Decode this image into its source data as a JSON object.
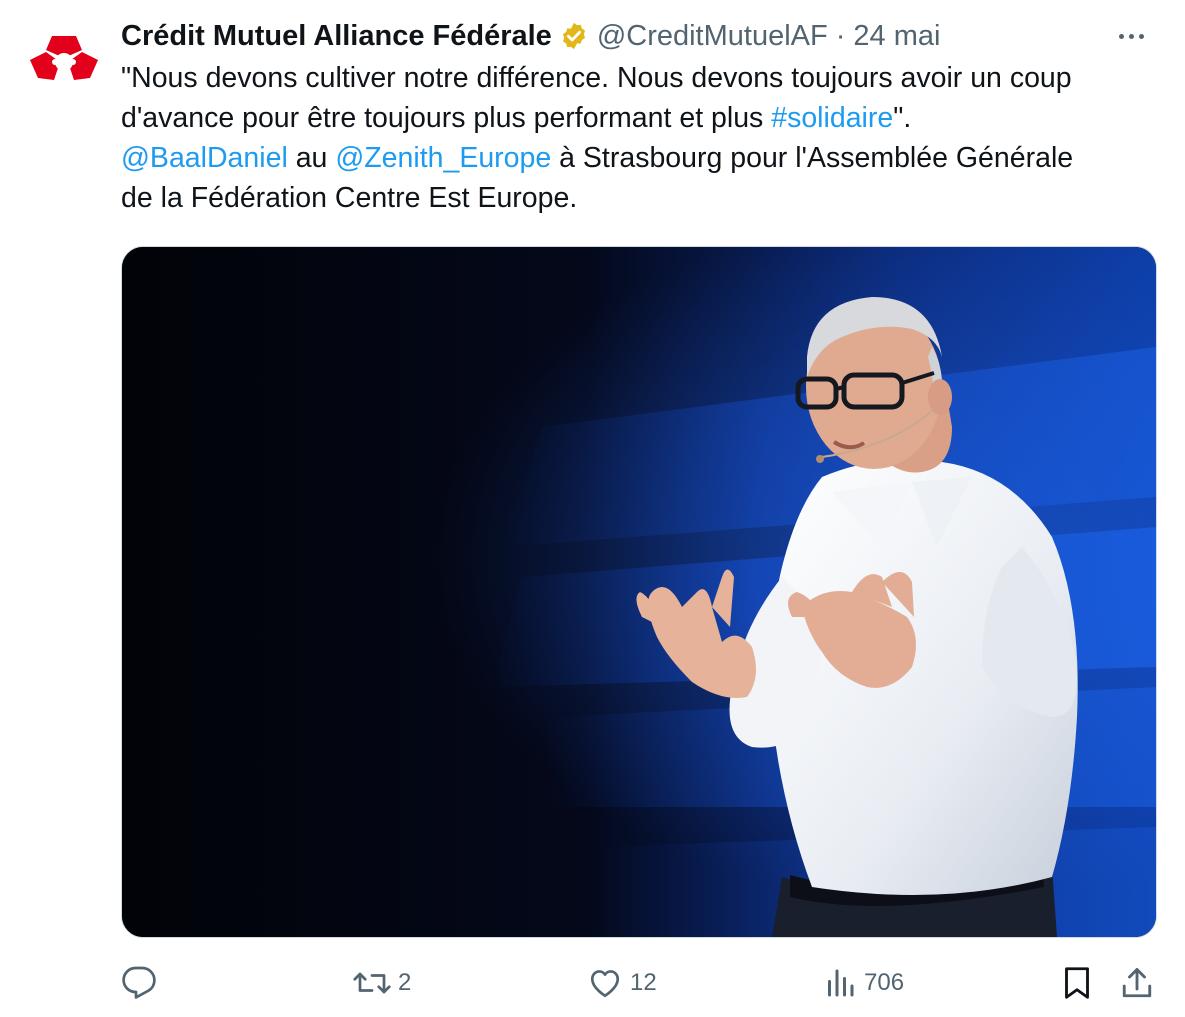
{
  "tweet": {
    "author": {
      "display_name": "Crédit Mutuel Alliance Fédérale",
      "handle": "@CreditMutuelAF",
      "separator": "·",
      "date": "24 mai",
      "verified_icon": "verified-gold-badge-icon",
      "avatar_icon": "credit-mutuel-logo",
      "brand_color": "#e2001a"
    },
    "text": {
      "line1": "\"Nous devons cultiver notre différence. Nous devons toujours avoir un coup",
      "line2_a": "d'avance pour être toujours plus performant et plus ",
      "hashtag": "#solidaire",
      "line2_b": "\".",
      "mention1": "@BaalDaniel",
      "line3_a": " au ",
      "mention2": "@Zenith_Europe",
      "line3_b": " à Strasbourg pour l'Assemblée Générale",
      "line4": "de la Fédération Centre Est Europe."
    },
    "media": {
      "type": "photo",
      "subject": "speaker-on-stage"
    },
    "actions": {
      "reply": {
        "icon": "reply-icon",
        "count": ""
      },
      "retweet": {
        "icon": "retweet-icon",
        "count": "2"
      },
      "like": {
        "icon": "heart-icon",
        "count": "12"
      },
      "views": {
        "icon": "views-chart-icon",
        "count": "706"
      },
      "bookmark": {
        "icon": "bookmark-icon"
      },
      "share": {
        "icon": "share-icon"
      }
    },
    "colors": {
      "link": "#1d9bf0",
      "secondary_text": "#536471",
      "verified_gold": "#e2b719"
    }
  }
}
